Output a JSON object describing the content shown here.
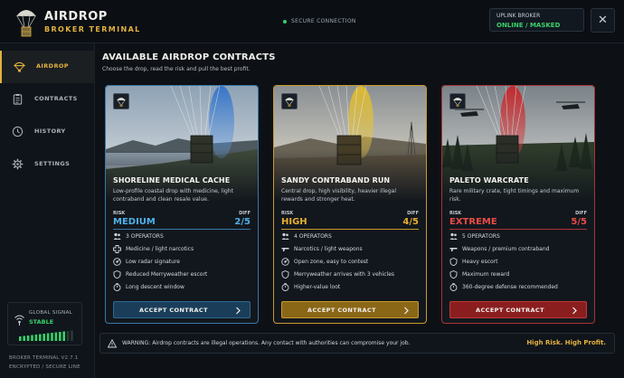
{
  "app": {
    "brand_title": "AIRDROP",
    "brand_subtitle": "BROKER TERMINAL",
    "secure_status": "SECURE CONNECTION",
    "uplink_label": "UPLINK BROKER",
    "uplink_status": "ONLINE / MASKED",
    "close_glyph": "✕"
  },
  "sidebar": {
    "items": [
      {
        "label": "AIRDROP",
        "icon": "parachute-icon",
        "active": true
      },
      {
        "label": "CONTRACTS",
        "icon": "clipboard-icon",
        "active": false
      },
      {
        "label": "HISTORY",
        "icon": "clock-icon",
        "active": false
      },
      {
        "label": "SETTINGS",
        "icon": "gear-icon",
        "active": false
      }
    ],
    "signal_label": "GLOBAL SIGNAL",
    "signal_status": "STABLE",
    "signal_level_bars": 12,
    "signal_total_bars": 14,
    "build_line1": "BROKER TERMINAL V2.7.1",
    "build_line2": "ENCRYPTED / SECURE LINE"
  },
  "main": {
    "title": "AVAILABLE AIRDROP CONTRACTS",
    "subtitle": "Choose the drop, read the risk and pull the best profit.",
    "cards": [
      {
        "name": "SHORELINE MEDICAL CACHE",
        "description": "Low-profile coastal drop with medicine, light contraband and clean resale value.",
        "risk_label": "RISK",
        "risk": "MEDIUM",
        "diff_label": "DIFF",
        "difficulty": "2/5",
        "features": [
          {
            "icon": "operators-icon",
            "text": "3 OPERATORS"
          },
          {
            "icon": "medical-cross-icon",
            "text": "Medicine / light narcotics"
          },
          {
            "icon": "radar-icon",
            "text": "Low radar signature"
          },
          {
            "icon": "shield-icon",
            "text": "Reduced Merryweather escort"
          },
          {
            "icon": "timer-icon",
            "text": "Long descent window"
          }
        ],
        "button": "ACCEPT CONTRACT",
        "accent": "#4fb1ea"
      },
      {
        "name": "SANDY CONTRABAND RUN",
        "description": "Central drop, high visibility, heavier illegal rewards and stronger heat.",
        "risk_label": "RISK",
        "risk": "HIGH",
        "diff_label": "DIFF",
        "difficulty": "4/5",
        "features": [
          {
            "icon": "operators-icon",
            "text": "4 OPERATORS"
          },
          {
            "icon": "weapon-icon",
            "text": "Narcotics / light weapons"
          },
          {
            "icon": "radar-icon",
            "text": "Open zone, easy to contest"
          },
          {
            "icon": "shield-icon",
            "text": "Merryweather arrives with 3 vehicles"
          },
          {
            "icon": "timer-icon",
            "text": "Higher-value loot"
          }
        ],
        "button": "ACCEPT CONTRACT",
        "accent": "#e8b030"
      },
      {
        "name": "PALETO WARCRATE",
        "description": "Rare military crate, tight timings and maximum risk.",
        "risk_label": "RISK",
        "risk": "EXTREME",
        "diff_label": "DIFF",
        "difficulty": "5/5",
        "features": [
          {
            "icon": "operators-icon",
            "text": "5 OPERATORS"
          },
          {
            "icon": "weapon-icon",
            "text": "Weapons / premium contraband"
          },
          {
            "icon": "shield-icon",
            "text": "Heavy escort"
          },
          {
            "icon": "shield-icon",
            "text": "Maximum reward"
          },
          {
            "icon": "timer-icon",
            "text": "360-degree defense recommended"
          }
        ],
        "button": "ACCEPT CONTRACT",
        "accent": "#ea4b45"
      }
    ]
  },
  "footer": {
    "warning": "WARNING: Airdrop contracts are illegal operations. Any contact with authorities can compromise your job.",
    "tagline": "High Risk. High Profit."
  },
  "colors": {
    "gold": "#e3b13d",
    "green": "#3ad06a",
    "background": "#0d1116"
  }
}
